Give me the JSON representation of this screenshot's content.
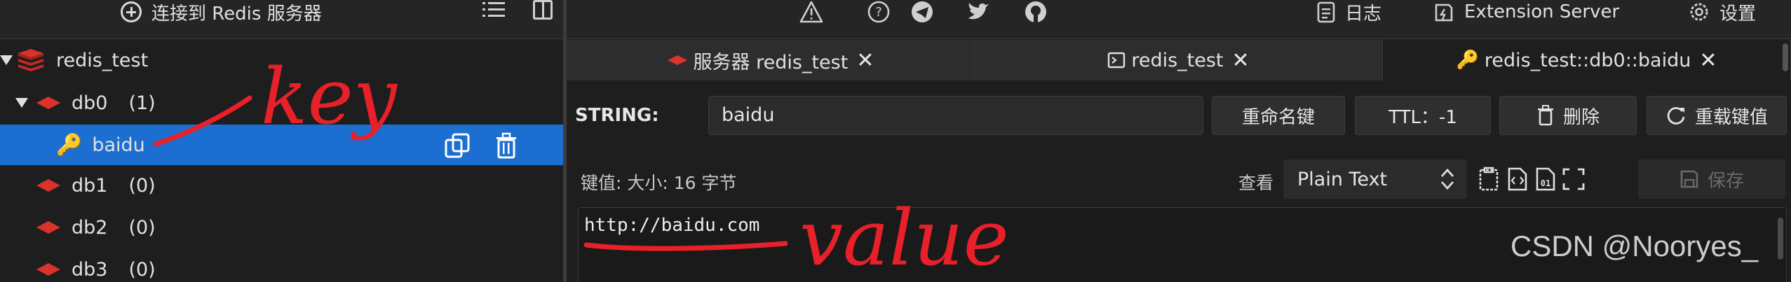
{
  "left": {
    "toolbar": {
      "connect_label": "连接到 Redis 服务器",
      "icons": [
        "plus-circle-icon",
        "list-icon",
        "panel-icon"
      ]
    },
    "tree": {
      "connection": "redis_test",
      "db0": {
        "name": "db0",
        "count": "(1)"
      },
      "selected_key": "baidu",
      "dbs": [
        {
          "name": "db1",
          "count": "(0)"
        },
        {
          "name": "db2",
          "count": "(0)"
        },
        {
          "name": "db3",
          "count": "(0)"
        }
      ]
    }
  },
  "header": {
    "icons": [
      "warning-icon",
      "help-icon",
      "telegram-icon",
      "twitter-icon",
      "github-icon"
    ],
    "log_label": "日志",
    "extension_label": "Extension Server",
    "settings_label": "设置"
  },
  "tabs": [
    {
      "label": "服务器 redis_test",
      "icon": "redis-icon"
    },
    {
      "label": "redis_test",
      "icon": "terminal-icon"
    },
    {
      "label": "redis_test::db0::baidu",
      "icon": "key-icon"
    }
  ],
  "key_panel": {
    "type_label": "STRING:",
    "key_name": "baidu",
    "rename_label": "重命名键",
    "ttl_label": "TTL：-1",
    "delete_label": "删除",
    "reload_label": "重载键值"
  },
  "value_panel": {
    "meta_label": "键值: 大小: 16 字节",
    "view_label": "查看",
    "view_mode": "Plain Text",
    "save_label": "保存",
    "value": "http://baidu.com"
  },
  "annotations": {
    "key": "key",
    "value": "value"
  },
  "watermark": "CSDN @Nooryes_",
  "colors": {
    "selected": "#1c6fd1",
    "redis_red": "#d9332b",
    "annotation": "#e8202a"
  }
}
